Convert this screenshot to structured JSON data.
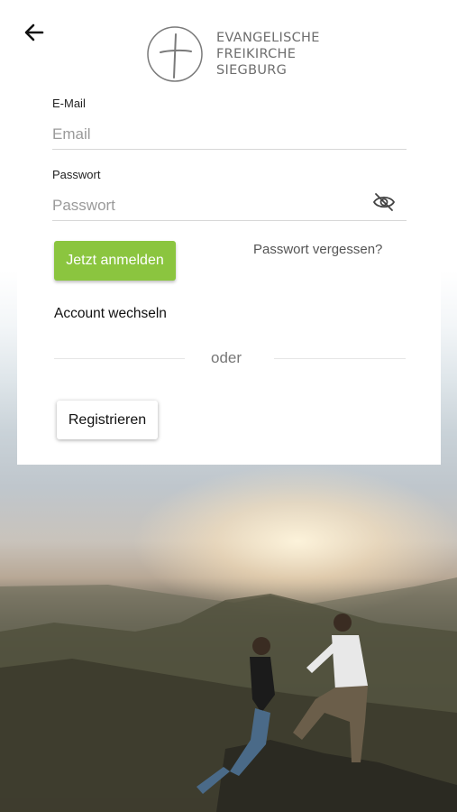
{
  "logo": {
    "line1": "EVANGELISCHE",
    "line2": "FREIKIRCHE",
    "line3": "SIEGBURG"
  },
  "email": {
    "label": "E-Mail",
    "placeholder": "Email"
  },
  "password": {
    "label": "Passwort",
    "placeholder": "Passwort"
  },
  "actions": {
    "login_label": "Jetzt anmelden",
    "forgot_label": "Passwort vergessen?",
    "switch_account_label": "Account wechseln",
    "divider_label": "oder",
    "register_label": "Registrieren"
  },
  "colors": {
    "primary": "#8bc53f",
    "text": "#222222",
    "muted": "#9a9a9a"
  },
  "icons": {
    "back": "arrow-left-icon",
    "visibility": "eye-off-icon",
    "logo": "cross-logo-icon"
  }
}
